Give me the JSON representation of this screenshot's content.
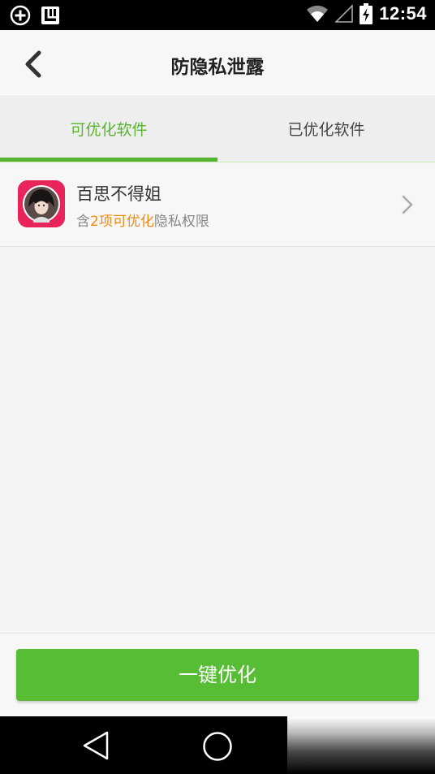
{
  "status_bar": {
    "time": "12:54",
    "icons": [
      "add-circle-icon",
      "app-notification-icon",
      "wifi-icon",
      "signal-icon",
      "battery-charging-icon"
    ]
  },
  "header": {
    "title": "防隐私泄露",
    "back_icon": "chevron-left-icon"
  },
  "tabs": [
    {
      "label": "可优化软件",
      "active": true
    },
    {
      "label": "已优化软件",
      "active": false
    }
  ],
  "app_list": [
    {
      "name": "百思不得姐",
      "desc_prefix": "含",
      "desc_highlight": "2项可优化",
      "desc_suffix": "隐私权限",
      "icon": "app-avatar-icon"
    }
  ],
  "action": {
    "optimize_label": "一键优化"
  },
  "nav_bar": {
    "icons": [
      "nav-back-icon",
      "nav-home-icon",
      "nav-recents-icon"
    ]
  },
  "colors": {
    "accent": "#58b531",
    "highlight": "#f08a10",
    "button": "#57bd35"
  }
}
